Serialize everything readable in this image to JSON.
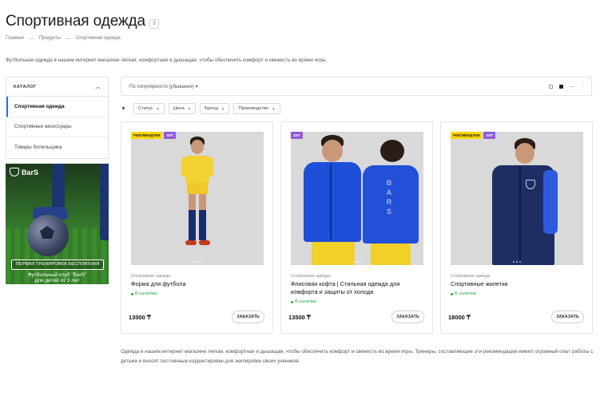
{
  "page": {
    "title": "Спортивная одежда",
    "count": "3",
    "intro": "Футбольная одежда в нашем интернет-магазине легкая, комфортная и дышащая, чтобы обеспечить комфорт и свежесть во время игры.",
    "bottom_text": "Одежда в нашем интернет-магазине легкая, комфортная и дышащая, чтобы обеспечить комфорт и свежесть во время игры. Тренеры, составляющие эти рекомендации имеют огромный опыт работы с детьми и вносят постоянные корректировки для экипировки своих учеников."
  },
  "breadcrumb": [
    "Главная",
    "Продукты",
    "Спортивная одежда"
  ],
  "catalog": {
    "title": "КАТАЛОГ",
    "items": [
      "Спортивная одежда",
      "Спортивные аксессуары",
      "Товары болельщика"
    ]
  },
  "promo": {
    "logo": "BarS",
    "button": "ПЕРВАЯ ТРЕНИРОВКА БЕСПЛАТНАЯ",
    "caption_line1": "Футбольный клуб \"BarS\"",
    "caption_line2": "для детей от 3 лет"
  },
  "sort": {
    "label": "По популярности (убывание)"
  },
  "filters": [
    "Статус",
    "Цена",
    "Бренд",
    "Производство"
  ],
  "products": [
    {
      "badges": [
        "РЕКОМЕНДУЕМ",
        "ХИТ"
      ],
      "category": "Спортивная одежда",
      "name": "Форма для футбола",
      "stock": "В наличии",
      "price": "13000 ₸",
      "order": "ЗАКАЗАТЬ"
    },
    {
      "badges": [
        "ХИТ"
      ],
      "category": "Спортивная одежда",
      "name": "Флисовая кофта | Стильная одежда для комфорта и защиты от холода",
      "stock": "В наличии",
      "price": "13500 ₸",
      "order": "ЗАКАЗАТЬ"
    },
    {
      "badges": [
        "РЕКОМЕНДУЕМ",
        "ХИТ"
      ],
      "category": "Спортивная одежда",
      "name": "Спортивные жилетки",
      "stock": "В наличии",
      "price": "18000 ₸",
      "order": "ЗАКАЗАТЬ"
    }
  ],
  "colors": {
    "accent": "#2d6cf0",
    "recommend": "#ffd600",
    "hit": "#8e5bd8",
    "in_stock": "#2aa84a"
  }
}
